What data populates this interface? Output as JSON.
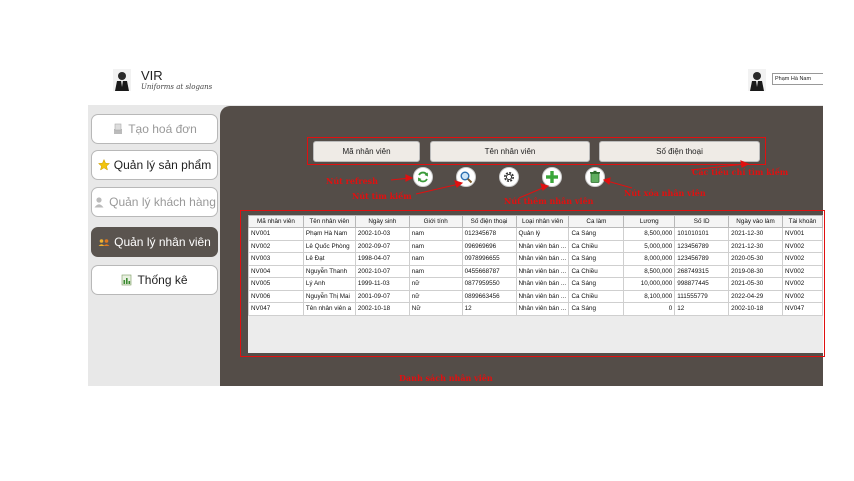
{
  "header": {
    "app_name": "VIR",
    "tagline": "Uniforms at slogans",
    "user_name": "Phạm Hà Nam"
  },
  "sidebar": {
    "items": [
      {
        "label": "Tạo hoá đơn",
        "icon": "receipt-icon",
        "state": "dim"
      },
      {
        "label": "Quản lý sản phẩm",
        "icon": "star-icon",
        "state": "normal"
      },
      {
        "label": "Quản lý khách hàng",
        "icon": "person-icon",
        "state": "dim"
      },
      {
        "label": "Quản lý nhân viên",
        "icon": "group-icon",
        "state": "active"
      },
      {
        "label": "Thống kê",
        "icon": "chart-icon",
        "state": "normal"
      }
    ]
  },
  "search": {
    "buttons": [
      "Mã nhân viên",
      "Tên nhân viên",
      "Số điện thoại"
    ]
  },
  "actions": {
    "icons": [
      "refresh-icon",
      "search-icon",
      "gear-icon",
      "add-icon",
      "delete-icon"
    ]
  },
  "annotations": {
    "search_fields": "Các tiêu chí tìm kiếm",
    "refresh": "Nút refresh",
    "search": "Nút tìm kiếm",
    "add": "Nút thêm nhân viên",
    "delete": "Nút xóa nhân viên",
    "list": "Danh sách nhân viên"
  },
  "table": {
    "columns": [
      "Mã nhân viên",
      "Tên nhân viên",
      "Ngày sinh",
      "Giới tính",
      "Số điện thoại",
      "Loại nhân viên",
      "Ca làm",
      "Lương",
      "Số ID",
      "Ngày vào làm",
      "Tài khoản"
    ],
    "rows": [
      [
        "NV001",
        "Phạm Hà Nam",
        "2002-10-03",
        "nam",
        "012345678",
        "Quản lý",
        "Ca Sáng",
        "8,500,000",
        "101010101",
        "2021-12-30",
        "NV001"
      ],
      [
        "NV002",
        "Lê Quốc Phòng",
        "2002-09-07",
        "nam",
        "096969696",
        "Nhân viên bán ...",
        "Ca Chiều",
        "5,000,000",
        "123456789",
        "2021-12-30",
        "NV002"
      ],
      [
        "NV003",
        "Lê Đạt",
        "1998-04-07",
        "nam",
        "0978996655",
        "Nhân viên bán ...",
        "Ca Sáng",
        "8,000,000",
        "123456789",
        "2020-05-30",
        "NV002"
      ],
      [
        "NV004",
        "Nguyễn Thanh",
        "2002-10-07",
        "nam",
        "0455668787",
        "Nhân viên bán ...",
        "Ca Chiều",
        "8,500,000",
        "268749315",
        "2019-08-30",
        "NV002"
      ],
      [
        "NV005",
        "Lý Anh",
        "1999-11-03",
        "nữ",
        "0877959550",
        "Nhân viên bán ...",
        "Ca Sáng",
        "10,000,000",
        "998877445",
        "2021-05-30",
        "NV002"
      ],
      [
        "NV006",
        "Nguyễn Thị Mai",
        "2001-09-07",
        "nữ",
        "0899663456",
        "Nhân viên bán ...",
        "Ca Chiều",
        "8,100,000",
        "111555779",
        "2022-04-29",
        "NV002"
      ],
      [
        "NV047",
        "Tên nhân viên a",
        "2002-10-18",
        "Nữ",
        "12",
        "Nhân viên bán ...",
        "Ca Sáng",
        "0",
        "12",
        "2002-10-18",
        "NV047"
      ]
    ]
  },
  "colors": {
    "main_panel": "#544d48",
    "annotation_red": "#e01010",
    "active_tab": "#5a544f"
  }
}
